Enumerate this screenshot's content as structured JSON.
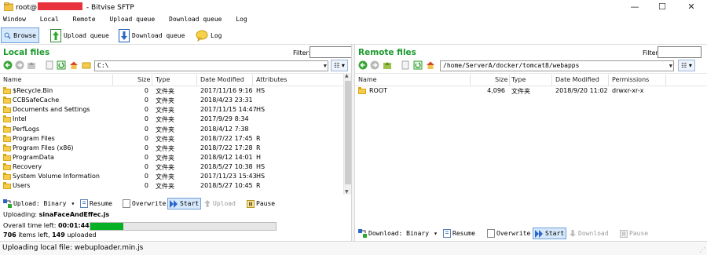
{
  "window": {
    "title_prefix": "root@",
    "title_suffix": " - Bitvise SFTP",
    "min_glyph": "—",
    "max_glyph": "☐",
    "close_glyph": "✕"
  },
  "menu": [
    "Window",
    "Local",
    "Remote",
    "Upload queue",
    "Download queue",
    "Log"
  ],
  "toolbar": {
    "browse": "Browse",
    "upload_queue": "Upload queue",
    "download_queue": "Download queue",
    "log": "Log"
  },
  "local": {
    "title": "Local files",
    "filter_label": "Filter:",
    "filter_value": "",
    "path": "C:\\",
    "columns": {
      "name": "Name",
      "size": "Size",
      "type": "Type",
      "date": "Date Modified",
      "attr": "Attributes"
    },
    "rows": [
      {
        "name": "$Recycle.Bin",
        "size": "0",
        "type": "文件夹",
        "date": "2017/11/16 9:16",
        "attr": "HS"
      },
      {
        "name": "CCBSafeCache",
        "size": "0",
        "type": "文件夹",
        "date": "2018/4/23 23:31",
        "attr": ""
      },
      {
        "name": "Documents and Settings",
        "size": "0",
        "type": "文件夹",
        "date": "2017/11/15 14:47",
        "attr": "HS"
      },
      {
        "name": "Intel",
        "size": "0",
        "type": "文件夹",
        "date": "2017/9/29 8:34",
        "attr": ""
      },
      {
        "name": "PerfLogs",
        "size": "0",
        "type": "文件夹",
        "date": "2018/4/12 7:38",
        "attr": ""
      },
      {
        "name": "Program Files",
        "size": "0",
        "type": "文件夹",
        "date": "2018/7/22 17:45",
        "attr": "R"
      },
      {
        "name": "Program Files (x86)",
        "size": "0",
        "type": "文件夹",
        "date": "2018/7/22 17:28",
        "attr": "R"
      },
      {
        "name": "ProgramData",
        "size": "0",
        "type": "文件夹",
        "date": "2018/9/12 14:01",
        "attr": "H"
      },
      {
        "name": "Recovery",
        "size": "0",
        "type": "文件夹",
        "date": "2018/5/27 10:38",
        "attr": "HS"
      },
      {
        "name": "System Volume Information",
        "size": "0",
        "type": "文件夹",
        "date": "2017/11/23 15:43",
        "attr": "HS"
      },
      {
        "name": "Users",
        "size": "0",
        "type": "文件夹",
        "date": "2018/5/27 10:45",
        "attr": "R"
      }
    ]
  },
  "remote": {
    "title": "Remote files",
    "filter_label": "Filter:",
    "filter_value": "",
    "path": "/home/ServerA/docker/tomcat8/webapps",
    "columns": {
      "name": "Name",
      "size": "Size",
      "type": "Type",
      "date": "Date Modified",
      "perm": "Permissions"
    },
    "rows": [
      {
        "name": "ROOT",
        "size": "4,096",
        "type": "文件夹",
        "date": "2018/9/20 11:02",
        "perm": "drwxr-xr-x"
      }
    ]
  },
  "upload_bar": {
    "mode": "Upload: Binary",
    "resume": "Resume",
    "overwrite": "Overwrite",
    "start": "Start",
    "upload": "Upload",
    "pause": "Pause"
  },
  "download_bar": {
    "mode": "Download: Binary",
    "resume": "Resume",
    "overwrite": "Overwrite",
    "start": "Start",
    "download": "Download",
    "pause": "Pause"
  },
  "upload_status": {
    "uploading_label": "Uploading:",
    "file": "sinaFaceAndEffec.js",
    "time_label": "Overall time left:",
    "time_left": "00:01:44",
    "items_left": "706",
    "items_left_label": "items left,",
    "uploaded": "149",
    "uploaded_label": "uploaded",
    "progress_fraction": 0.18
  },
  "status_bar": {
    "text": "Uploading local file: webuploader.min.js"
  },
  "colors": {
    "pane_title": "#1b9a2e",
    "redaction": "#e8323c",
    "progress": "#06b025",
    "folder": "#f5cd4b"
  }
}
